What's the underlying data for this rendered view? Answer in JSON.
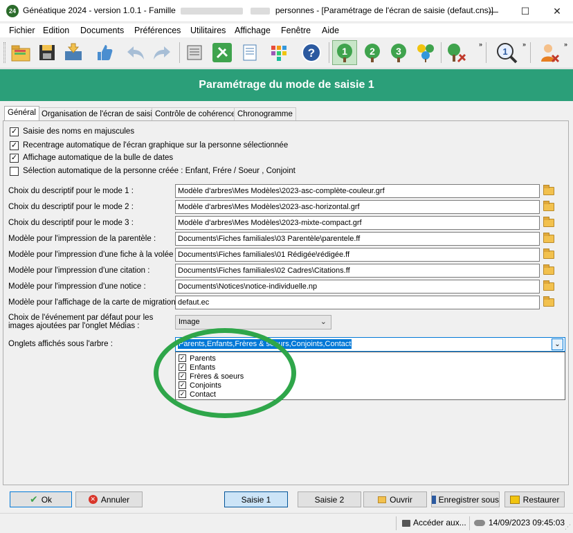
{
  "window": {
    "app_icon": "24",
    "title_part1": "Généatique 2024 - version 1.0.1 - Famille",
    "title_part2": "personnes - [Paramétrage de l'écran de saisie (defaut.cns)]",
    "minimize": "—",
    "maximize": "☐",
    "close": "✕"
  },
  "menu": [
    "Fichier",
    "Edition",
    "Documents",
    "Préférences",
    "Utilitaires",
    "Affichage",
    "Fenêtre",
    "Aide"
  ],
  "toolbar": {
    "icons": [
      "open-folder-icon",
      "save-disk-icon",
      "export-icon",
      "thumbs-up-icon",
      "undo-icon",
      "redo-icon",
      "print-icon",
      "tools-icon",
      "document-icon",
      "palette-icon",
      "help-icon",
      "tree-mode-1-icon",
      "tree-mode-2-icon",
      "tree-mode-3-icon",
      "tree-group-icon",
      "tree-tools-icon",
      "search-mode-icon",
      "user-delete-icon"
    ],
    "num_1": "1",
    "num_2": "2",
    "num_3": "3",
    "help_char": "?",
    "chevron": "»"
  },
  "banner": {
    "title": "Paramétrage du mode de saisie 1"
  },
  "tabs": [
    "Général",
    "Organisation de l'écran de saisie",
    "Contrôle de cohérence",
    "Chronogramme"
  ],
  "general": {
    "checkboxes": [
      {
        "label": "Saisie des noms en majuscules",
        "checked": true
      },
      {
        "label": "Recentrage automatique de l'écran graphique sur la personne sélectionnée",
        "checked": true
      },
      {
        "label": "Affichage automatique de la bulle de dates",
        "checked": true
      },
      {
        "label": "Sélection automatique de la personne créée : Enfant, Frére / Soeur , Conjoint",
        "checked": false
      }
    ],
    "fields": [
      {
        "label": "Choix du descriptif pour le mode 1 :",
        "value": "Modèle d'arbres\\Mes Modèles\\2023-asc-complète-couleur.grf"
      },
      {
        "label": "Choix du descriptif pour le mode 2 :",
        "value": "Modèle d'arbres\\Mes Modèles\\2023-asc-horizontal.grf"
      },
      {
        "label": "Choix du descriptif pour le mode 3 :",
        "value": "Modèle d'arbres\\Mes Modèles\\2023-mixte-compact.grf"
      },
      {
        "label": "Modèle pour l'impression de la parentèle :",
        "value": "Documents\\Fiches familiales\\03 Parentèle\\parentele.ff"
      },
      {
        "label": "Modèle pour l'impression d'une fiche à la volée :",
        "value": "Documents\\Fiches familiales\\01 Rédigée\\rédigée.ff"
      },
      {
        "label": "Modèle pour l'impression d'une citation :",
        "value": "Documents\\Fiches familiales\\02 Cadres\\Citations.ff"
      },
      {
        "label": "Modèle pour l'impression d'une notice :",
        "value": "Documents\\Notices\\notice-individuelle.np"
      },
      {
        "label": "Modèle pour l'affichage de la carte de migration :",
        "value": "defaut.ec"
      }
    ],
    "media_event": {
      "label_line1": "Choix de l'événement par défaut pour les",
      "label_line2": "images ajoutées par l'onglet Médias :",
      "selected": "Image"
    },
    "tree_tabs": {
      "label": "Onglets affichés sous l'arbre :",
      "value": "Parents,Enfants,Frères & soeurs,Conjoints,Contact",
      "options": [
        {
          "label": "Parents",
          "checked": true
        },
        {
          "label": "Enfants",
          "checked": true
        },
        {
          "label": "Frères & soeurs",
          "checked": true
        },
        {
          "label": "Conjoints",
          "checked": true
        },
        {
          "label": "Contact",
          "checked": true
        }
      ]
    }
  },
  "buttons": {
    "ok": "Ok",
    "cancel": "Annuler",
    "saisie1": "Saisie 1",
    "saisie2": "Saisie 2",
    "open": "Ouvrir",
    "save_as": "Enregistrer sous",
    "restore": "Restaurer"
  },
  "status": {
    "access": "Accéder aux...",
    "datetime": "14/09/2023 09:45:03"
  },
  "colors": {
    "banner": "#2b9f79",
    "selection": "#0078d7",
    "annotation": "#2fa64a"
  }
}
